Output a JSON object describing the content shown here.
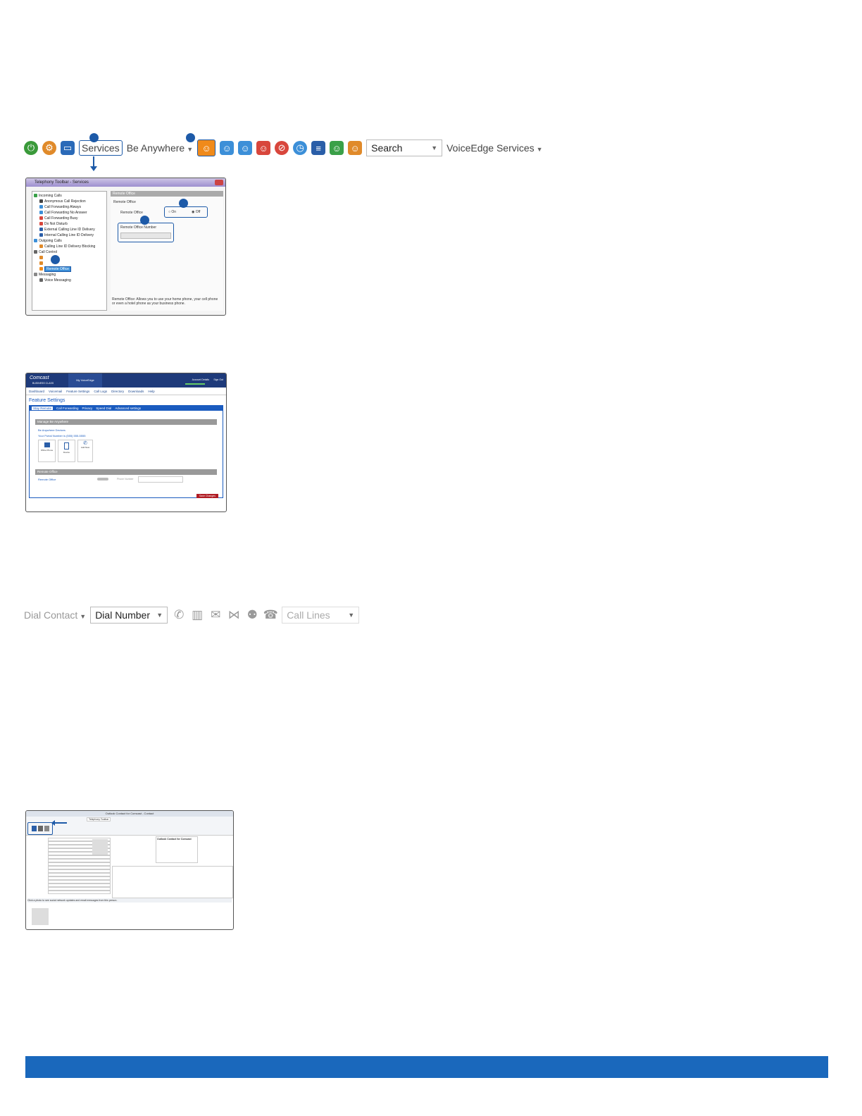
{
  "toolbar1": {
    "services_label": "Services",
    "be_anywhere_label": "Be Anywhere",
    "search_label": "Search",
    "voiceedge_label": "VoiceEdge Services"
  },
  "services_window": {
    "title": "Telephony Toolbar - Services",
    "tree": {
      "incoming": "Incoming Calls",
      "items_incoming": [
        "Anonymous Call Rejection",
        "Call Forwarding Always",
        "Call Forwarding No Answer",
        "Call Forwarding Busy",
        "Do Not Disturb",
        "External Calling Line ID Delivery",
        "Internal Calling Line ID Delivery"
      ],
      "outgoing": "Outgoing Calls",
      "items_outgoing": [
        "Calling Line ID Delivery Blocking"
      ],
      "call_control": "Call Control",
      "items_call_control": [
        "Remote Office"
      ],
      "messaging": "Messaging",
      "items_messaging": [
        "Voice Messaging"
      ]
    },
    "panel_header": "Remote Office",
    "group_label": "Remote Office",
    "field_label": "Remote Office",
    "on_label": "On",
    "off_label": "Off",
    "number_label": "Remote Office Number",
    "description": "Remote Office: Allows you to use your home phone, your cell phone or even a hotel phone as your business phone."
  },
  "comcast_window": {
    "brand": "Comcast",
    "brand_sub": "BUSINESS CLASS",
    "top_tab": "My VoiceEdge",
    "account_details": "Account Details",
    "sign_out": "Sign Out",
    "nav": [
      "Dashboard",
      "Voicemail",
      "Feature Settings",
      "Call Logs",
      "Directory",
      "Downloads",
      "Help"
    ],
    "page_title": "Feature Settings",
    "tabs": [
      "Stay Remote",
      "Call Forwarding",
      "Privacy",
      "Speed Dial",
      "Advanced settings"
    ],
    "section1": "Manage Be Anywhere",
    "be_anywhere_devices": "Be Anywhere Devices",
    "portal_number": "Your Portal Number is (555) 555-5555",
    "devices": [
      "Office Phone",
      "Device",
      "Add New"
    ],
    "section2": "Remote Office",
    "remote_office_label": "Remote Office",
    "phone_number_label": "Phone Number",
    "save_button": "Save Changes"
  },
  "toolbar2": {
    "dial_contact": "Dial Contact",
    "dial_number": "Dial Number",
    "call_lines": "Call Lines"
  },
  "outlook_window": {
    "title": "Outlook Contact for Comcast - Contact",
    "ribbon_tab": "Telephony Toolbar",
    "contact_card": "Outlook Contact for Comcast",
    "social_prompt": "Click a photo to see social network updates and email messages from this person."
  },
  "colors": {
    "accent": "#1d5aa8",
    "footer": "#1a68bc"
  }
}
